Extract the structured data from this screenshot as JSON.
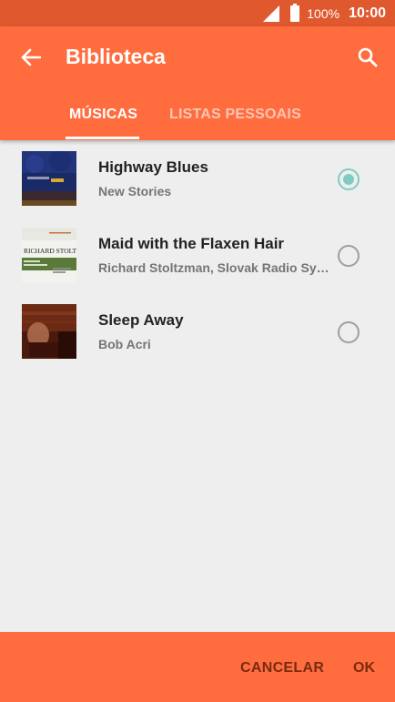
{
  "status_bar": {
    "battery": "100%",
    "time": "10:00"
  },
  "header": {
    "title": "Biblioteca"
  },
  "tabs": [
    {
      "label": "MÚSICAS",
      "active": true
    },
    {
      "label": "LISTAS PESSOAIS",
      "active": false
    }
  ],
  "songs": [
    {
      "title": "Highway Blues",
      "artist": "New Stories",
      "selected": true
    },
    {
      "title": "Maid with the Flaxen Hair",
      "artist": "Richard Stoltzman, Slovak Radio Symphony Orchestra",
      "selected": false
    },
    {
      "title": "Sleep Away",
      "artist": "Bob Acri",
      "selected": false
    }
  ],
  "album_art_text": {
    "richard_stoltzman": "RICHARD STOLTZMAN"
  },
  "actions": {
    "cancel": "CANCELAR",
    "ok": "OK"
  },
  "colors": {
    "status_bar": "#e0582e",
    "app_bar": "#ff6d3f",
    "radio_checked": "#80cbc4",
    "background": "#eeeeee"
  },
  "icons": {
    "back": "arrow-left-icon",
    "search": "search-icon",
    "signal": "signal-icon",
    "battery": "battery-icon"
  }
}
